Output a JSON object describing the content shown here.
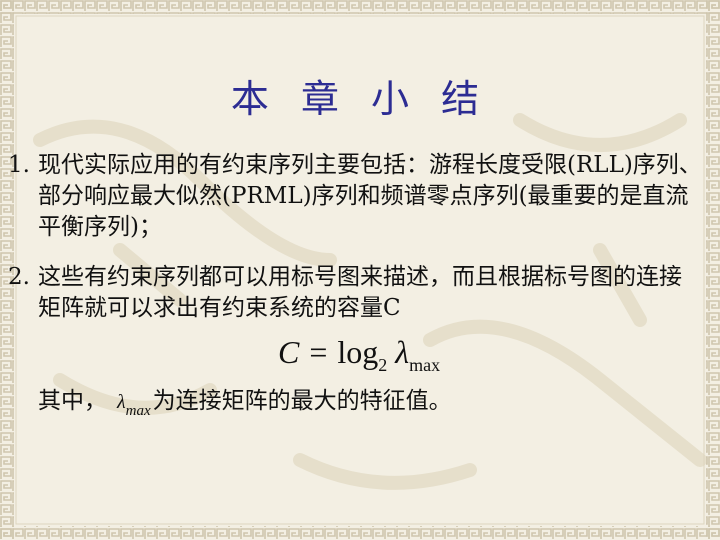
{
  "slide": {
    "title": "本 章 小 结",
    "items": [
      {
        "number": "1.",
        "text": "现代实际应用的有约束序列主要包括：游程长度受限(RLL)序列、部分响应最大似然(PRML)序列和频谱零点序列(最重要的是直流平衡序列)；"
      },
      {
        "number": "2.",
        "text": "这些有约束序列都可以用标号图来描述，而且根据标号图的连接矩阵就可以求出有约束系统的容量C"
      }
    ],
    "formula": {
      "lhs": "C",
      "op": "=",
      "func": "log",
      "base": "2",
      "symbol": "λ",
      "subscript": "max"
    },
    "note": {
      "prefix": "其中，",
      "symbol": "λ",
      "subscript": "max",
      "suffix": "为连接矩阵的最大的特征值。"
    }
  },
  "colors": {
    "background": "#f3efe3",
    "title": "#2c2c93",
    "text": "#111111",
    "border_pattern": "#d4cdb8"
  },
  "icons": [
    "border-pattern-decoration"
  ]
}
